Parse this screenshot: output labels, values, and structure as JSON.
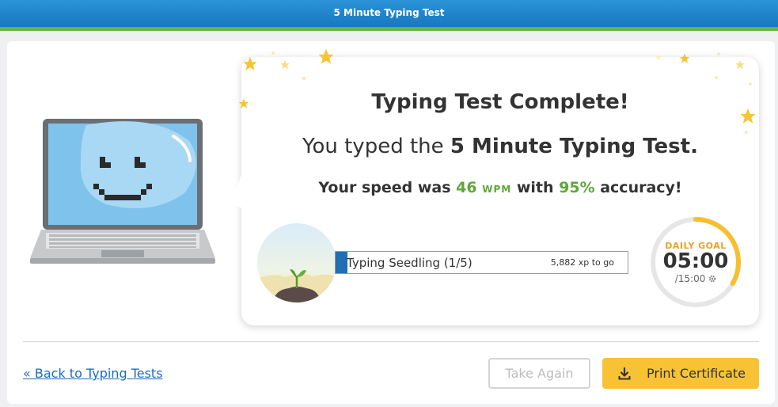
{
  "header": {
    "title": "5 Minute Typing Test"
  },
  "result": {
    "heading": "Typing Test Complete!",
    "sub_prefix": "You typed the ",
    "sub_test": "5 Minute Typing Test.",
    "speed_prefix": "Your speed was ",
    "wpm": "46",
    "wpm_unit": "WPM",
    "speed_mid": " with ",
    "accuracy": "95%",
    "speed_suffix": " accuracy!"
  },
  "progress": {
    "label": "Typing Seedling (1/5)",
    "xp_to_go": "5,882 xp to go",
    "fill_fraction": 0.04
  },
  "daily_goal": {
    "label": "DAILY GOAL",
    "time": "05:00",
    "total": "/15:00",
    "fraction": 0.333
  },
  "footer": {
    "back_link": "« Back to Typing Tests",
    "take_again": "Take Again",
    "print_certificate": "Print Certificate"
  },
  "icons": {
    "goal_settings": "gear-icon",
    "certificate": "download-icon"
  },
  "colors": {
    "header": "#1b84cc",
    "accent_green": "#5ea83a",
    "goal_orange": "#f0a024",
    "button_yellow": "#f8c235",
    "link_blue": "#1b6cc4"
  }
}
